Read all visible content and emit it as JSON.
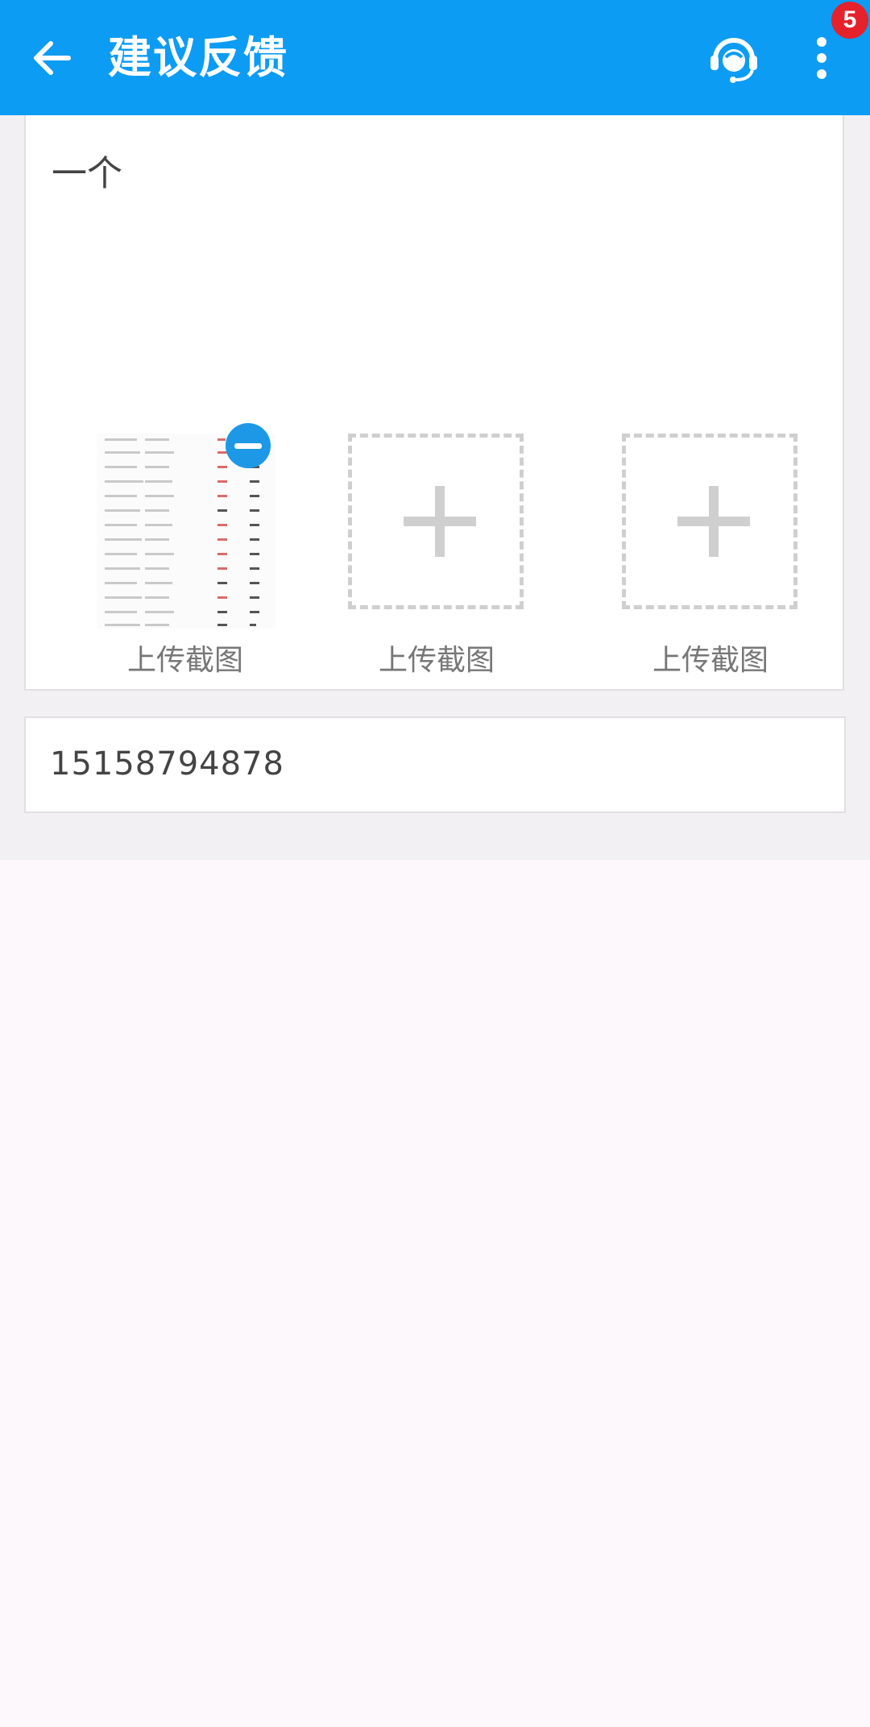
{
  "header": {
    "title": "建议反馈",
    "badge_count": "5",
    "bg_color": "#0c9cf3"
  },
  "icons": {
    "back": "arrow-left-icon",
    "support": "headset-support-icon",
    "more": "more-vertical-icon",
    "remove": "remove-circle-icon",
    "add": "plus-icon"
  },
  "feedback": {
    "text": "一个"
  },
  "screenshots": [
    {
      "label": "上传截图",
      "state": "uploaded"
    },
    {
      "label": "上传截图",
      "state": "empty"
    },
    {
      "label": "上传截图",
      "state": "empty"
    }
  ],
  "contact": {
    "value": "15158794878"
  }
}
